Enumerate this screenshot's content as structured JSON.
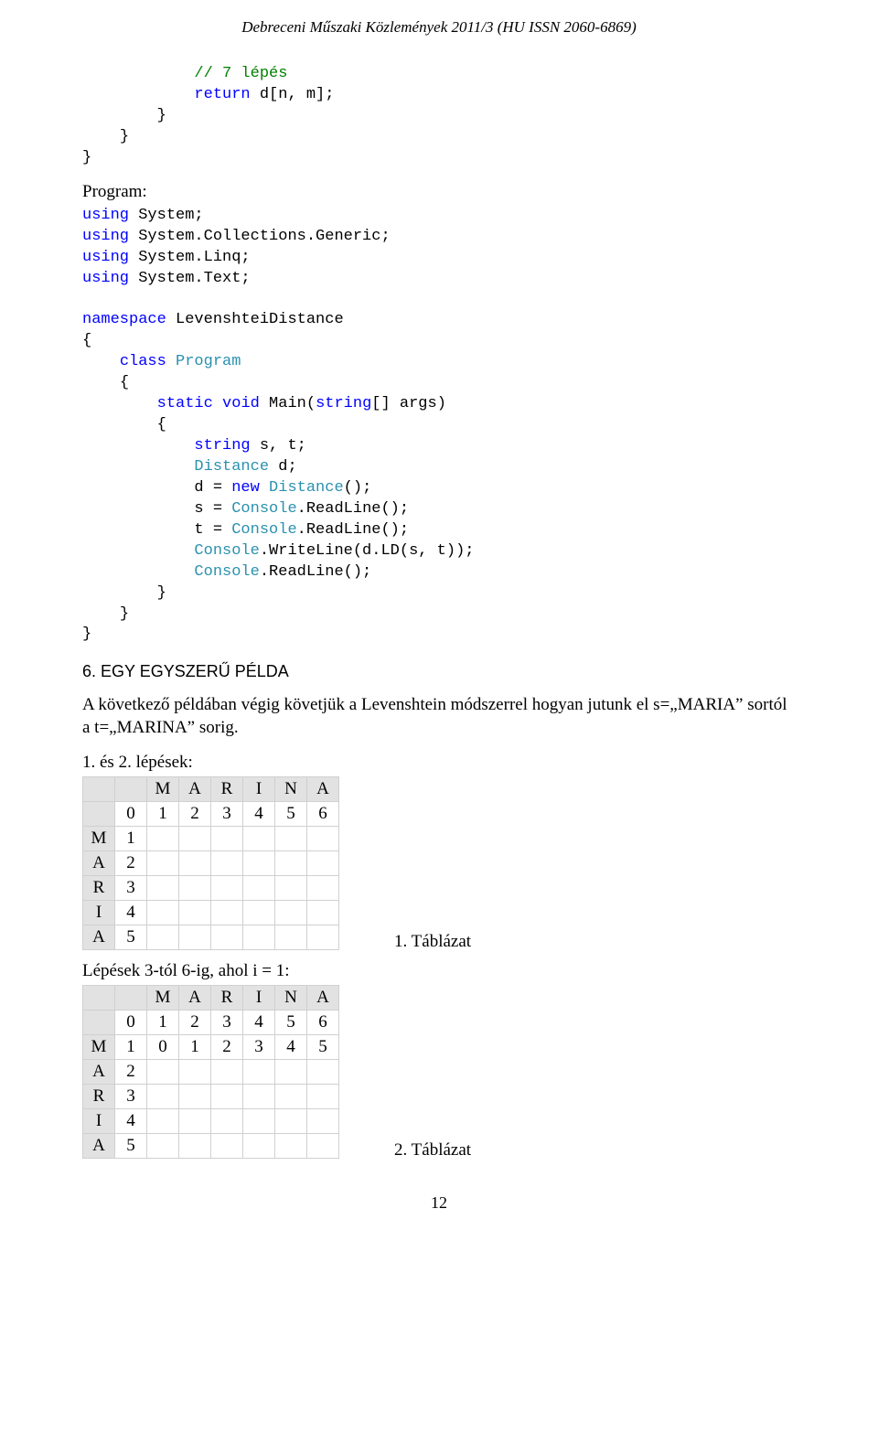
{
  "header": "Debreceni Műszaki Közlemények 2011/3 (HU ISSN 2060-6869)",
  "code": {
    "c1": "// 7 lépés",
    "ret": "return",
    "retTail": " d[n, m];",
    "br": "}",
    "programLabel": "Program:",
    "u1a": "using",
    "u1b": " System;",
    "u2a": "using",
    "u2b": " System.Collections.Generic;",
    "u3a": "using",
    "u3b": " System.Linq;",
    "u4a": "using",
    "u4b": " System.Text;",
    "ns": "namespace",
    "nsTail": " LevenshteiDistance",
    "lb": "{",
    "cls": "class",
    "clsName": "Program",
    "stat": "static",
    "void": "void",
    "mainSig": " Main(",
    "stringKw": "string",
    "mainTail": "[] args)",
    "strDecl1": "string",
    "strDecl1b": " s, t;",
    "distType": "Distance",
    "distTail": " d;",
    "newKw": "new",
    "newTypeTail": "Distance",
    "newTail": "();",
    "assignD": "            d = ",
    "assignS": "            s = ",
    "assignT": "            t = ",
    "cons": "Console",
    "read": ".ReadLine();",
    "write": ".WriteLine(d.LD(s, t));"
  },
  "section": "6. EGY EGYSZERŰ PÉLDA",
  "para": "A következő példában végig követjük a Levenshtein módszerrel hogyan jutunk el s=„MARIA” sortól a t=„MARINA” sorig.",
  "stepsLabel": "1. és 2. lépések:",
  "table1": {
    "cols": [
      "M",
      "A",
      "R",
      "I",
      "N",
      "A"
    ],
    "nums": [
      "0",
      "1",
      "2",
      "3",
      "4",
      "5",
      "6"
    ],
    "rows": [
      {
        "label": "M",
        "val": "1"
      },
      {
        "label": "A",
        "val": "2"
      },
      {
        "label": "R",
        "val": "3"
      },
      {
        "label": "I",
        "val": "4"
      },
      {
        "label": "A",
        "val": "5"
      }
    ]
  },
  "caption1": "1.   Táblázat",
  "steps2Label": "Lépések 3-tól 6-ig, ahol i = 1:",
  "table2": {
    "cols": [
      "M",
      "A",
      "R",
      "I",
      "N",
      "A"
    ],
    "nums": [
      "0",
      "1",
      "2",
      "3",
      "4",
      "5",
      "6"
    ],
    "rows": [
      {
        "label": "M",
        "vals": [
          "1",
          "0",
          "1",
          "2",
          "3",
          "4",
          "5"
        ]
      },
      {
        "label": "A",
        "vals": [
          "2",
          "",
          "",
          "",
          "",
          "",
          ""
        ]
      },
      {
        "label": "R",
        "vals": [
          "3",
          "",
          "",
          "",
          "",
          "",
          ""
        ]
      },
      {
        "label": "I",
        "vals": [
          "4",
          "",
          "",
          "",
          "",
          "",
          ""
        ]
      },
      {
        "label": "A",
        "vals": [
          "5",
          "",
          "",
          "",
          "",
          "",
          ""
        ]
      }
    ]
  },
  "caption2": "2.   Táblázat",
  "pageNumber": "12"
}
